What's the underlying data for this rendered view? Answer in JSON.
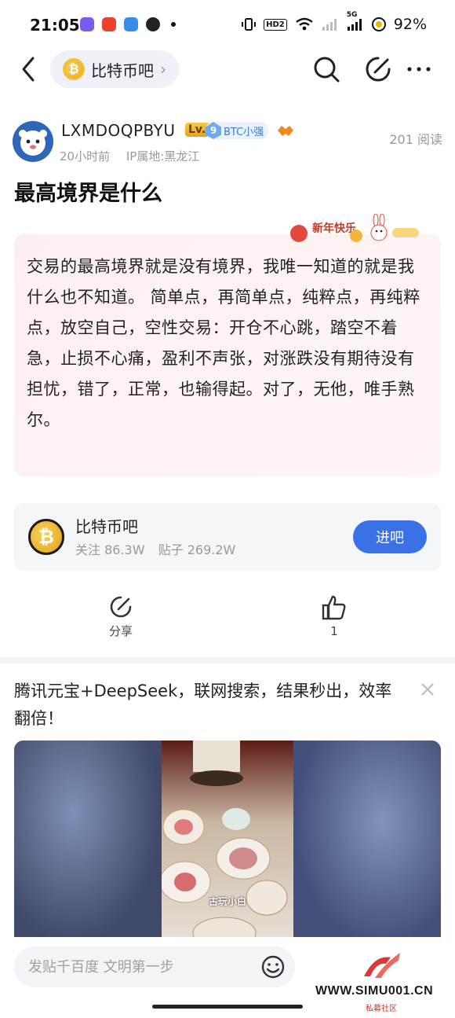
{
  "status_bar": {
    "time": "21:05",
    "battery": "92%",
    "network_label": "5G",
    "hd_label": "HD2"
  },
  "nav": {
    "forum_name": "比特币吧"
  },
  "post": {
    "author": "LXMDOQPBYU",
    "level_badge": "Lv.8",
    "fan_level": "9",
    "fan_name": "BTC小强",
    "time_ago": "20小时前",
    "ip_location": "IP属地:黑龙江",
    "read_count": "201 阅读",
    "title": "最高境界是什么",
    "content": "交易的最高境界就是没有境界，我唯一知道的就是我什么也不知道。 简单点，再简单点，纯粹点，再纯粹点，放空自己，空性交易：开仓不心跳，踏空不着急，止损不心痛，盈利不声张，对涨跌没有期待没有担忧，错了，正常，也输得起。对了，无他，唯手熟尔。",
    "decoration_text": "新年快乐"
  },
  "forum_card": {
    "name": "比特币吧",
    "followers": "关注 86.3W",
    "posts": "贴子 269.2W",
    "enter_label": "进吧"
  },
  "actions": {
    "share_label": "分享",
    "like_count": "1"
  },
  "ad": {
    "title": "腾讯元宝+DeepSeek，联网搜索，结果秒出，效率翻倍！",
    "video_caption": "古玩小白"
  },
  "bottom": {
    "comment_placeholder": "发贴千百度 文明第一步",
    "watermark_url": "WWW.SIMU001.CN",
    "watermark_sub": "私募社区"
  },
  "colors": {
    "accent": "#3a71e6",
    "card_bg": "#fdeff1",
    "badge_gold": "#f1b73a"
  }
}
